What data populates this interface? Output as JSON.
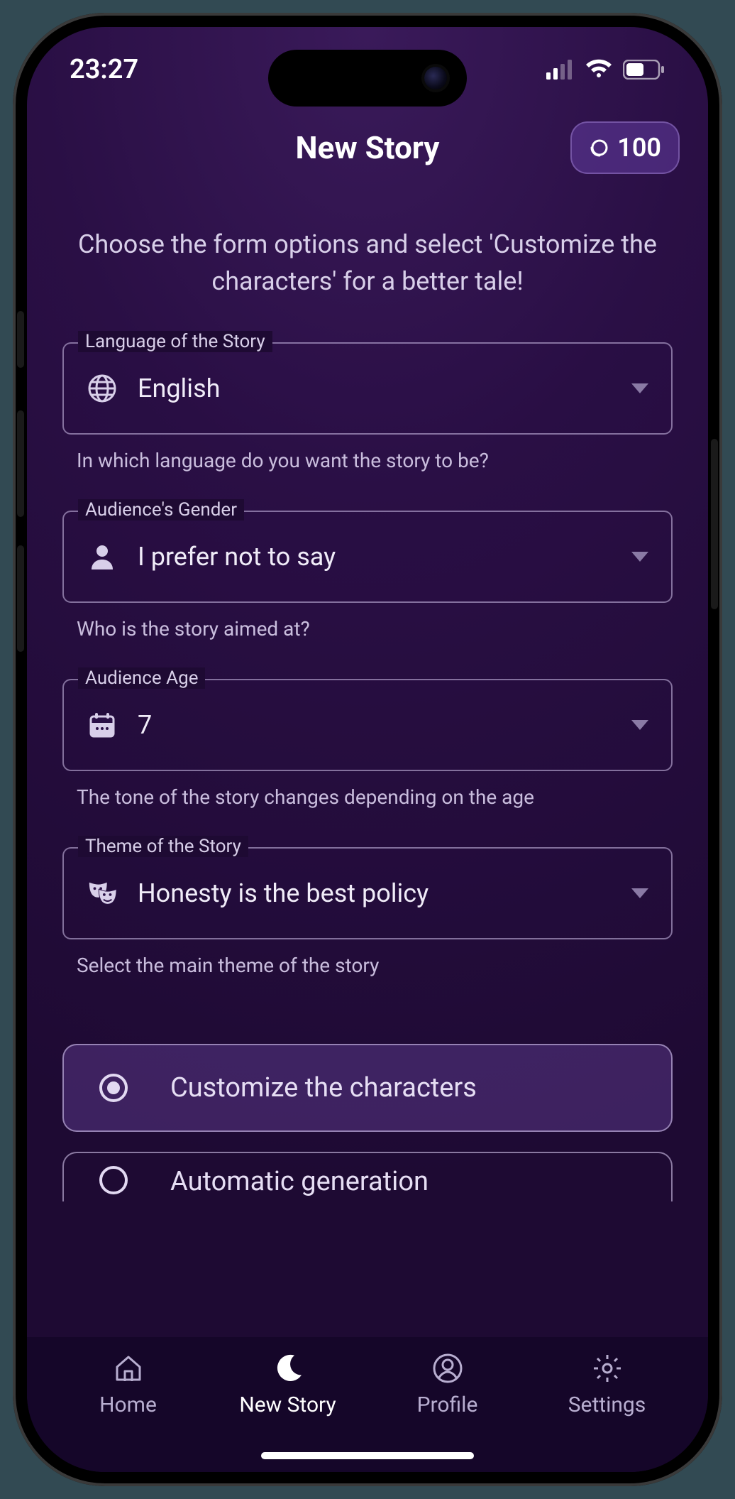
{
  "status": {
    "time": "23:27"
  },
  "header": {
    "title": "New Story",
    "credits": "100"
  },
  "subtitle": "Choose the form options and select 'Customize the characters' for a better tale!",
  "fields": {
    "language": {
      "legend": "Language of the Story",
      "value": "English",
      "helper": "In which language do you want the story to be?"
    },
    "gender": {
      "legend": "Audience's Gender",
      "value": "I prefer not to say",
      "helper": "Who is the story aimed at?"
    },
    "age": {
      "legend": "Audience Age",
      "value": "7",
      "helper": "The tone of the story changes depending on the age"
    },
    "theme": {
      "legend": "Theme of the Story",
      "value": "Honesty is the best policy",
      "helper": "Select the main theme of the story"
    }
  },
  "options": {
    "customize": "Customize the characters",
    "automatic": "Automatic generation"
  },
  "nav": {
    "home": "Home",
    "new_story": "New Story",
    "profile": "Profile",
    "settings": "Settings"
  }
}
